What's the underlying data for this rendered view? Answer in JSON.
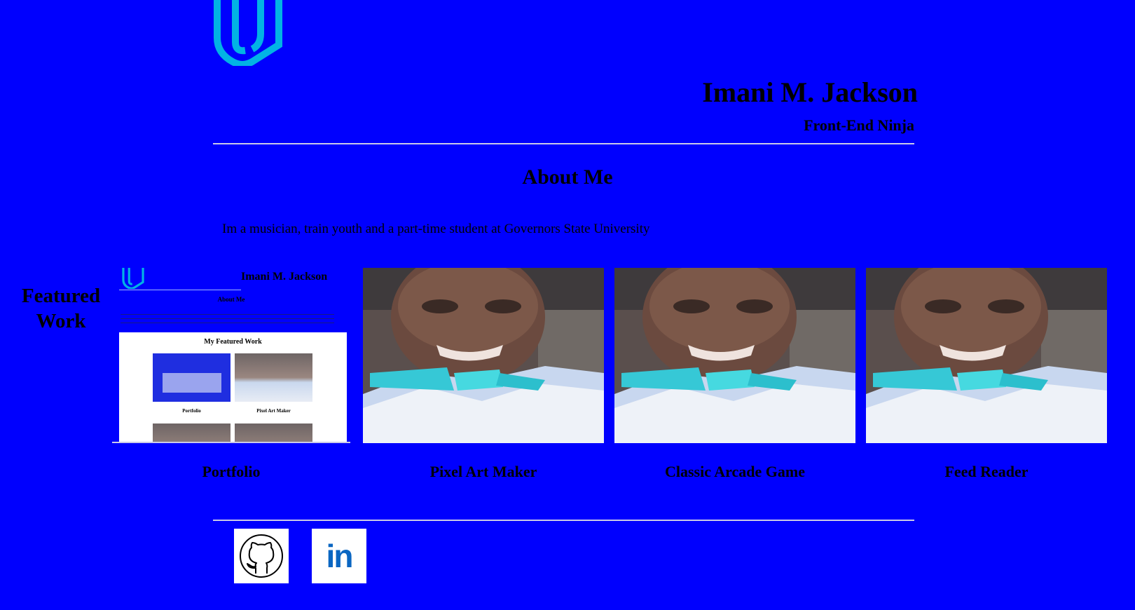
{
  "header": {
    "logo_icon": "udacity-logo-icon",
    "name": "Imani M. Jackson",
    "role": "Front-End Ninja"
  },
  "about": {
    "title": "About Me",
    "text": "Im a musician, train youth and a part-time student at Governors State University"
  },
  "featured": {
    "label": "Featured Work",
    "items": [
      {
        "caption": "Portfolio",
        "image": "portfolio-screenshot"
      },
      {
        "caption": "Pixel Art Maker",
        "image": "profile-photo"
      },
      {
        "caption": "Classic Arcade Game",
        "image": "profile-photo"
      },
      {
        "caption": "Feed Reader",
        "image": "profile-photo"
      }
    ],
    "mini_preview": {
      "name": "Imani M. Jackson",
      "about": "About Me",
      "inner_title": "My Featured Work",
      "captions": [
        "Portfolio",
        "Pixel Art Maker"
      ]
    }
  },
  "social": [
    {
      "icon": "github-icon"
    },
    {
      "icon": "linkedin-icon",
      "text": "in"
    }
  ],
  "colors": {
    "background": "#0000fe",
    "rule": "#c9c9e8",
    "logo": "#02b3e4",
    "linkedin": "#0a66c2"
  }
}
